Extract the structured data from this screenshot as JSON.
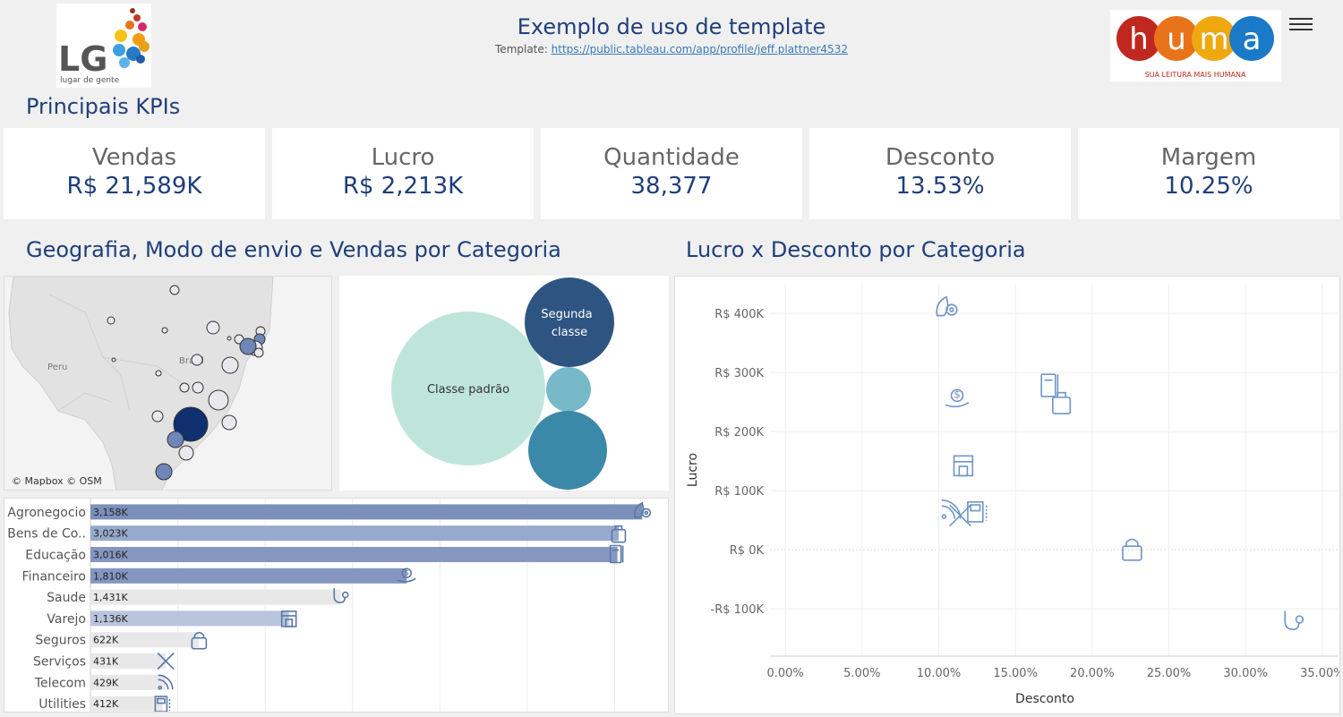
{
  "header": {
    "title": "Exemplo de uso de template",
    "subtitle_prefix": "Template: ",
    "subtitle_link": "https://public.tableau.com/app/profile/jeff.plattner4532",
    "logo_left_text": "LG",
    "logo_left_tagline": "lugar de gente",
    "logo_right_text": [
      "h",
      "u",
      "m",
      "a"
    ],
    "logo_right_tagline": "SUA LEITURA MAIS HUMANA",
    "menu_icon": "hamburger-icon"
  },
  "kpis_title": "Principais KPIs",
  "kpis": [
    {
      "label": "Vendas",
      "value": "R$ 21,589K"
    },
    {
      "label": "Lucro",
      "value": "R$ 2,213K"
    },
    {
      "label": "Quantidade",
      "value": "38,377"
    },
    {
      "label": "Desconto",
      "value": "13.53%"
    },
    {
      "label": "Margem",
      "value": "10.25%"
    }
  ],
  "left_section_title": "Geografia, Modo de envio e Vendas por Categoria",
  "right_section_title": "Lucro x Desconto por Categoria",
  "map": {
    "labels": [
      "Peru",
      "Brasil"
    ],
    "attribution": "© Mapbox © OSM",
    "colors": {
      "land": "#e4e4e4",
      "sea": "#f2f2f2",
      "dark": "#0f2f6e",
      "mid": "#6f86b8",
      "light": "#e8e8ee"
    }
  },
  "bubbles": {
    "items": [
      {
        "label": "Classe padrão",
        "color": "#bfe5da",
        "text_color": "#333333"
      },
      {
        "label": "Segunda classe",
        "label_lines": [
          "Segunda",
          "classe"
        ],
        "color": "#2e5582",
        "text_color": "#ffffff"
      },
      {
        "label": "",
        "color": "#77b9c8",
        "text_color": "#ffffff"
      },
      {
        "label": "",
        "color": "#3a89a8",
        "text_color": "#ffffff"
      }
    ]
  },
  "chart_data": [
    {
      "type": "bar",
      "orientation": "horizontal",
      "categories": [
        "Agronegocio",
        "Bens de Co..",
        "Educação",
        "Financeiro",
        "Saude",
        "Varejo",
        "Seguros",
        "Serviços",
        "Telecom",
        "Utilities"
      ],
      "values": [
        3158,
        3023,
        3016,
        1810,
        1431,
        1136,
        622,
        431,
        429,
        412
      ],
      "data_labels": [
        "3,158K",
        "3,023K",
        "3,016K",
        "1,810K",
        "1,431K",
        "1,136K",
        "622K",
        "431K",
        "429K",
        "412K"
      ],
      "bar_colors": [
        "#7b8fbb",
        "#97a9cc",
        "#8596c0",
        "#8596c0",
        "#e8e8e8",
        "#b9c5dc",
        "#e8e8e8",
        "#e8e8e8",
        "#e8e8e8",
        "#e8e8e8"
      ],
      "icons": [
        "agro-icon",
        "shopping-bag-icon",
        "book-icon",
        "money-hand-icon",
        "stethoscope-icon",
        "store-icon",
        "lock-icon",
        "tools-icon",
        "wifi-icon",
        "meter-icon"
      ],
      "xlim": [
        0,
        3300
      ]
    },
    {
      "type": "scatter",
      "xlabel": "Desconto",
      "ylabel": "Lucro",
      "xlim": [
        -0.01,
        0.36
      ],
      "ylim": [
        -180000,
        450000
      ],
      "x_ticks": [
        0,
        0.05,
        0.1,
        0.15,
        0.2,
        0.25,
        0.3,
        0.35
      ],
      "x_tick_labels": [
        "0.00%",
        "5.00%",
        "10.00%",
        "15.00%",
        "20.00%",
        "25.00%",
        "30.00%",
        "35.00%"
      ],
      "y_ticks": [
        -100000,
        0,
        100000,
        200000,
        300000,
        400000
      ],
      "y_tick_labels": [
        "-R$ 100K",
        "R$ 0K",
        "R$ 100K",
        "R$ 200K",
        "R$ 300K",
        "R$ 400K"
      ],
      "points": [
        {
          "category": "Agronegocio",
          "x": 0.105,
          "y": 408000,
          "icon": "agro-icon"
        },
        {
          "category": "Financeiro",
          "x": 0.112,
          "y": 255000,
          "icon": "money-hand-icon"
        },
        {
          "category": "Educação",
          "x": 0.173,
          "y": 277000,
          "icon": "book-icon"
        },
        {
          "category": "Bens de Co..",
          "x": 0.18,
          "y": 250000,
          "icon": "shopping-bag-icon"
        },
        {
          "category": "Varejo",
          "x": 0.116,
          "y": 143000,
          "icon": "store-icon"
        },
        {
          "category": "Telecom",
          "x": 0.108,
          "y": 68000,
          "icon": "wifi-icon"
        },
        {
          "category": "Utilities",
          "x": 0.125,
          "y": 65000,
          "icon": "meter-icon"
        },
        {
          "category": "Serviços",
          "x": 0.114,
          "y": 58000,
          "icon": "tools-icon"
        },
        {
          "category": "Seguros",
          "x": 0.226,
          "y": 2000,
          "icon": "lock-icon"
        },
        {
          "category": "Saude",
          "x": 0.331,
          "y": -123000,
          "icon": "stethoscope-icon"
        }
      ],
      "grid": true
    }
  ]
}
